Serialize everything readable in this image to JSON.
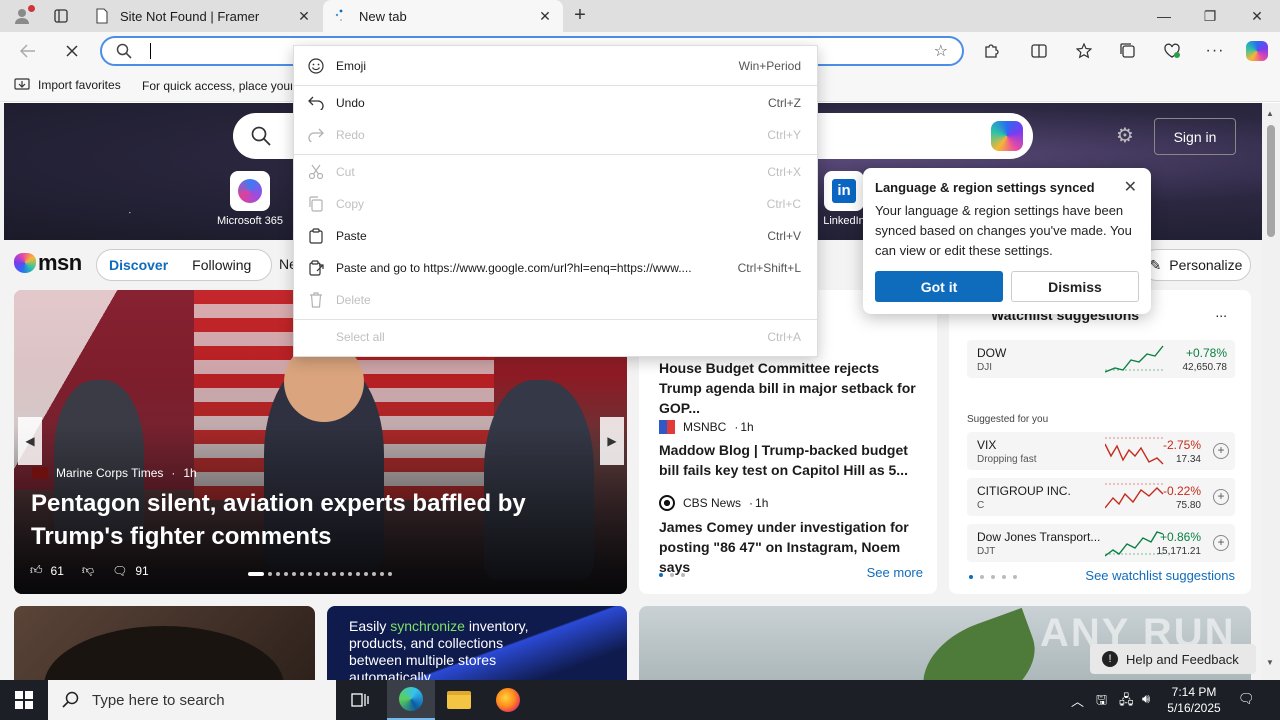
{
  "tabs": [
    {
      "title": "Site Not Found | Framer",
      "close": "✕"
    },
    {
      "title": "New tab",
      "close": "✕"
    }
  ],
  "window_controls": {
    "minimize": "—",
    "restore": "❐",
    "close": "✕"
  },
  "favorites": {
    "import_label": "Import favorites",
    "hint": "For quick access, place your"
  },
  "page": {
    "signin_label": "Sign in",
    "quick_links": [
      {
        "label": "Microsoft 365"
      },
      {
        "label": "LinkedIn"
      }
    ],
    "msn": {
      "logo": "msn",
      "tabs": [
        "Discover",
        "Following"
      ],
      "more": "Ne",
      "personalize": "Personalize"
    },
    "hero_story": {
      "source": "Marine Corps Times",
      "age": "1h",
      "headline": "Pentagon silent, aviation experts baffled by Trump's fighter comments",
      "likes": "61",
      "comments": "91"
    },
    "news": [
      {
        "source": "",
        "age": "",
        "title": "House Budget Committee rejects Trump agenda bill in major setback for GOP..."
      },
      {
        "source": "MSNBC",
        "age": "1h",
        "title": "Maddow Blog | Trump-backed budget bill fails key test on Capitol Hill as 5..."
      },
      {
        "source": "CBS News",
        "age": "1h",
        "title": "James Comey under investigation for posting \"86 47\" on Instagram, Noem says"
      }
    ],
    "news_see_more": "See more",
    "watchlist": {
      "title": "Watchlist suggestions",
      "more": "...",
      "suggested_label": "Suggested for you",
      "see_all": "See watchlist suggestions",
      "stocks": [
        {
          "name": "DOW",
          "symbol": "DJI",
          "change": "+0.78%",
          "price": "42,650.78",
          "direction": "up"
        },
        {
          "name": "VIX",
          "symbol": "Dropping fast",
          "change": "-2.75%",
          "price": "17.34",
          "direction": "down"
        },
        {
          "name": "CITIGROUP INC.",
          "symbol": "C",
          "change": "-0.22%",
          "price": "75.80",
          "direction": "down"
        },
        {
          "name": "Dow Jones Transport...",
          "symbol": "DJT",
          "change": "+0.86%",
          "price": "15,171.21",
          "direction": "up"
        }
      ]
    },
    "promo": {
      "line_before": "Easily ",
      "highlight": "synchronize",
      "line_after": " inventory, products, and collections between multiple stores automatically"
    },
    "help_label": "Help and Feedback",
    "watermark": "ANY RUN"
  },
  "toast": {
    "title": "Language & region settings synced",
    "body": "Your language & region settings have been synced based on changes you've made. You can view or edit these settings.",
    "primary": "Got it",
    "secondary": "Dismiss"
  },
  "context_menu": [
    {
      "label": "Emoji",
      "shortcut": "Win+Period",
      "enabled": true,
      "icon": "emoji-icon"
    },
    {
      "label": "Undo",
      "shortcut": "Ctrl+Z",
      "enabled": true,
      "icon": "undo-icon"
    },
    {
      "label": "Redo",
      "shortcut": "Ctrl+Y",
      "enabled": false,
      "icon": "redo-icon"
    },
    {
      "label": "Cut",
      "shortcut": "Ctrl+X",
      "enabled": false,
      "icon": "cut-icon"
    },
    {
      "label": "Copy",
      "shortcut": "Ctrl+C",
      "enabled": false,
      "icon": "copy-icon"
    },
    {
      "label": "Paste",
      "shortcut": "Ctrl+V",
      "enabled": true,
      "icon": "paste-icon"
    },
    {
      "label": "Paste and go to https://www.google.com/url?hl=enq=https://www....",
      "shortcut": "Ctrl+Shift+L",
      "enabled": true,
      "icon": "paste-go-icon"
    },
    {
      "label": "Delete",
      "shortcut": "",
      "enabled": false,
      "icon": "delete-icon"
    },
    {
      "label": "Select all",
      "shortcut": "Ctrl+A",
      "enabled": false,
      "icon": ""
    }
  ],
  "taskbar": {
    "search_placeholder": "Type here to search",
    "time": "7:14 PM",
    "date": "5/16/2025"
  },
  "colors": {
    "accent": "#0f6cbd",
    "address_focus": "#4a8ee8",
    "stock_up": "#0b8043",
    "stock_down": "#c42b1c",
    "taskbar": "#1c2026"
  }
}
